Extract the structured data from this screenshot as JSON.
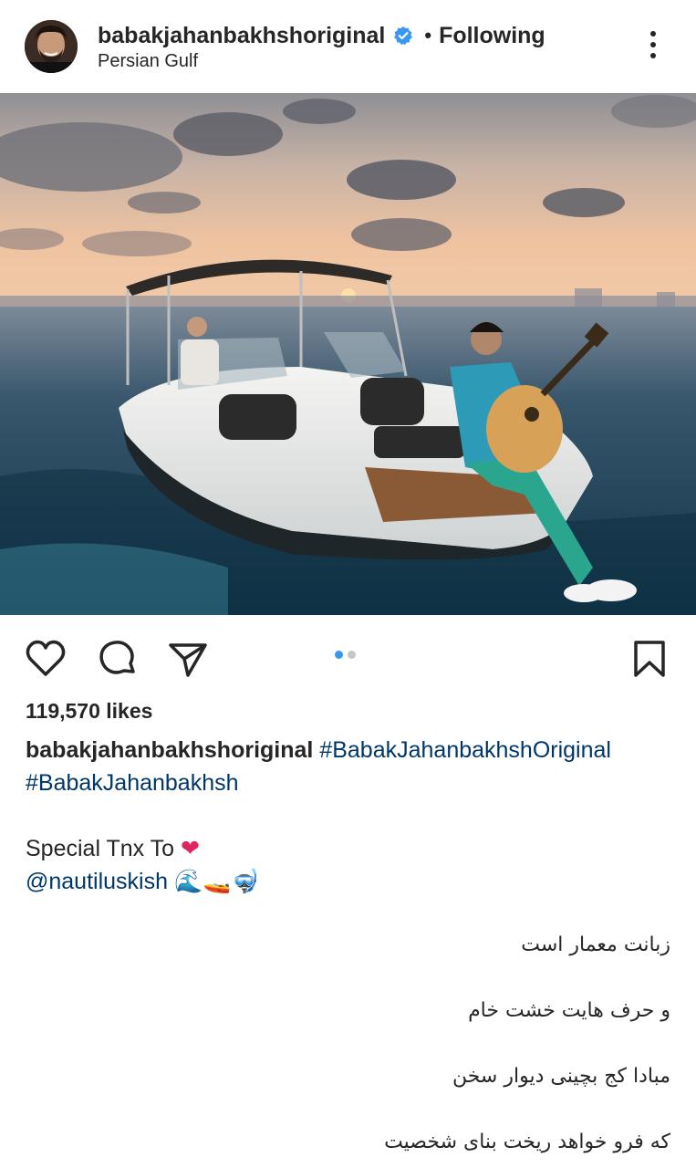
{
  "post": {
    "username": "babakjahanbakhshoriginal",
    "follow_separator": "•",
    "follow_status": "Following",
    "location": "Persian Gulf"
  },
  "carousel": {
    "current_index": 1,
    "total": 2
  },
  "likes": "119,570 likes",
  "caption": {
    "username": "babakjahanbakhshoriginal",
    "hashtag1": "#BabakJahanbakhshOriginal",
    "hashtag2": "#BabakJahanbakhsh",
    "thanks_text": "Special Tnx To",
    "heart": "❤",
    "mention": "@nautiluskish",
    "emojis": "🌊🚤🤿",
    "poem": [
      "زبانت معمار است",
      "و حرف هایت خشت خام",
      "مبادا کج بچینی دیوار سخن",
      "که فرو خواهد ریخت بنای شخصیت"
    ]
  },
  "icons": {
    "like": "heart-icon",
    "comment": "comment-icon",
    "share": "send-icon",
    "save": "bookmark-icon",
    "more": "more-vertical-icon",
    "verified": "verified-badge-icon"
  },
  "colors": {
    "hashtag": "#00376b",
    "verified": "#3897f0",
    "carousel_active": "#3897f0",
    "carousel_inactive": "#c7c7c7"
  }
}
